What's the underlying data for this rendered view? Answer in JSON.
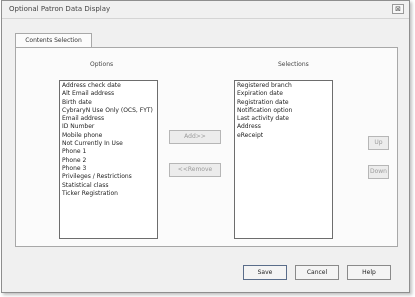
{
  "window": {
    "title": "Optional Patron Data Display",
    "close_label": "⊠"
  },
  "tab": {
    "label": "Contents Selection"
  },
  "options": {
    "label": "Options",
    "items": [
      "Address check date",
      "Alt Email address",
      "Birth date",
      "CybraryN Use Only (OCS, FYT)",
      "Email address",
      "ID Number",
      "Mobile phone",
      "Not Currently In Use",
      "Phone 1",
      "Phone 2",
      "Phone 3",
      "Privileges / Restrictions",
      "Statistical class",
      "Ticker Registration"
    ]
  },
  "selections": {
    "label": "Selections",
    "items": [
      "Registered branch",
      "Expiration date",
      "Registration date",
      "Notification option",
      "Last activity date",
      "Address",
      "eReceipt"
    ]
  },
  "buttons": {
    "add": "Add>>",
    "remove": "<<Remove",
    "up": "Up",
    "down": "Down",
    "save": "Save",
    "cancel": "Cancel",
    "help": "Help"
  }
}
